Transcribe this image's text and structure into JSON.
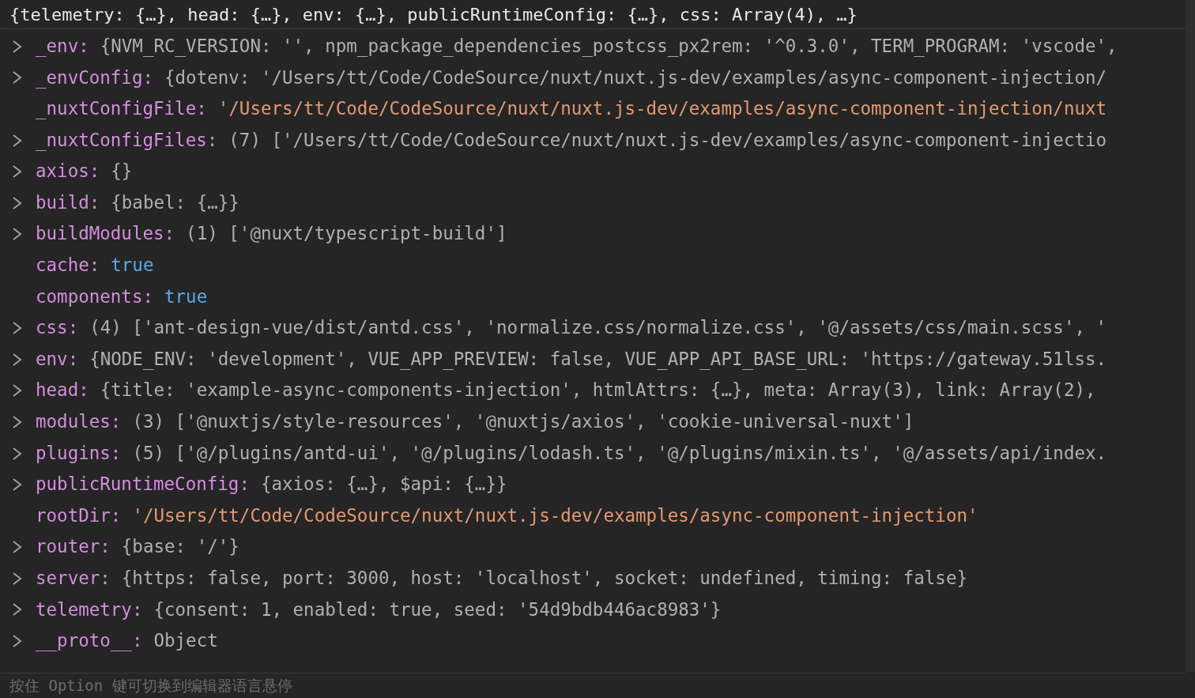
{
  "summary": "{telemetry: {…}, head: {…}, env: {…}, publicRuntimeConfig: {…}, css: Array(4), …}",
  "properties": [
    {
      "key": "_env:",
      "expandable": true,
      "kind": "preview",
      "value": "{NVM_RC_VERSION: '', npm_package_dependencies_postcss_px2rem: '^0.3.0', TERM_PROGRAM: 'vscode',"
    },
    {
      "key": "_envConfig:",
      "expandable": true,
      "kind": "preview",
      "value": "{dotenv: '/Users/tt/Code/CodeSource/nuxt/nuxt.js-dev/examples/async-component-injection/"
    },
    {
      "key": "_nuxtConfigFile:",
      "expandable": false,
      "kind": "string",
      "value": "'/Users/tt/Code/CodeSource/nuxt/nuxt.js-dev/examples/async-component-injection/nuxt"
    },
    {
      "key": "_nuxtConfigFiles:",
      "expandable": true,
      "kind": "preview",
      "value": "(7) ['/Users/tt/Code/CodeSource/nuxt/nuxt.js-dev/examples/async-component-injectio"
    },
    {
      "key": "axios:",
      "expandable": true,
      "kind": "preview",
      "value": "{}"
    },
    {
      "key": "build:",
      "expandable": true,
      "kind": "preview",
      "value": "{babel: {…}}"
    },
    {
      "key": "buildModules:",
      "expandable": true,
      "kind": "preview",
      "value": "(1) ['@nuxt/typescript-build']"
    },
    {
      "key": "cache:",
      "expandable": false,
      "kind": "boolean",
      "value": "true"
    },
    {
      "key": "components:",
      "expandable": false,
      "kind": "boolean",
      "value": "true"
    },
    {
      "key": "css:",
      "expandable": true,
      "kind": "preview",
      "value": "(4) ['ant-design-vue/dist/antd.css', 'normalize.css/normalize.css', '@/assets/css/main.scss', '"
    },
    {
      "key": "env:",
      "expandable": true,
      "kind": "preview",
      "value": "{NODE_ENV: 'development', VUE_APP_PREVIEW: false, VUE_APP_API_BASE_URL: 'https://gateway.51lss."
    },
    {
      "key": "head:",
      "expandable": true,
      "kind": "preview",
      "value": "{title: 'example-async-components-injection', htmlAttrs: {…}, meta: Array(3), link: Array(2),"
    },
    {
      "key": "modules:",
      "expandable": true,
      "kind": "preview",
      "value": "(3) ['@nuxtjs/style-resources', '@nuxtjs/axios', 'cookie-universal-nuxt']"
    },
    {
      "key": "plugins:",
      "expandable": true,
      "kind": "preview",
      "value": "(5) ['@/plugins/antd-ui', '@/plugins/lodash.ts', '@/plugins/mixin.ts', '@/assets/api/index."
    },
    {
      "key": "publicRuntimeConfig:",
      "expandable": true,
      "kind": "preview",
      "value": "{axios: {…}, $api: {…}}"
    },
    {
      "key": "rootDir:",
      "expandable": false,
      "kind": "string",
      "value": "'/Users/tt/Code/CodeSource/nuxt/nuxt.js-dev/examples/async-component-injection'"
    },
    {
      "key": "router:",
      "expandable": true,
      "kind": "preview",
      "value": "{base: '/'}"
    },
    {
      "key": "server:",
      "expandable": true,
      "kind": "preview",
      "value": "{https: false, port: 3000, host: 'localhost', socket: undefined, timing: false}"
    },
    {
      "key": "telemetry:",
      "expandable": true,
      "kind": "preview",
      "value": "{consent: 1, enabled: true, seed: '54d9bdb446ac8983'}"
    },
    {
      "key": "__proto__:",
      "expandable": true,
      "kind": "preview",
      "value": "Object"
    }
  ],
  "status_bar": "按住 Option 键可切换到编辑器语言悬停"
}
